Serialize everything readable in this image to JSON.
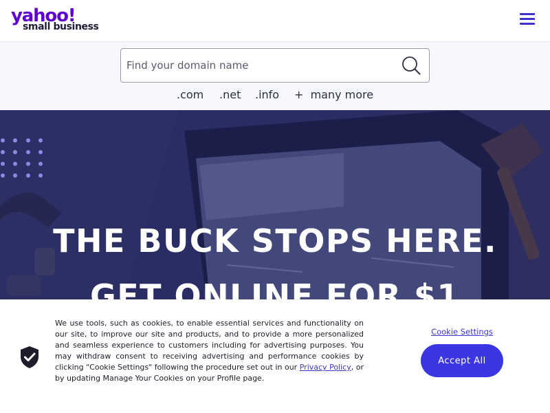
{
  "header": {
    "logo_main": "yahoo!",
    "logo_sub": "small business",
    "menu_icon": "hamburger-menu-icon",
    "brand_color": "#5f01d1"
  },
  "search": {
    "placeholder": "Find your domain name",
    "value": "",
    "icon": "search-icon",
    "tlds": [
      ".com",
      ".net",
      ".info",
      "+  many more"
    ]
  },
  "hero": {
    "line1": "THE BUCK STOPS HERE.",
    "line2": "GET ONLINE FOR $1"
  },
  "cookie_banner": {
    "text_before_link": "We use tools, such as cookies, to enable essential services and functionality on our site, to improve our site and products, and to provide a more personalized and seamless experience to customers including for advertising purposes. You may withdraw consent to receiving advertising and performance cookies by clicking \"Cookie Settings\" following the procedure set out in our ",
    "privacy_link": "Privacy Policy",
    "text_after_link": ", or by updating Manage Your Cookies on your Profile page.",
    "settings_label": "Cookie Settings",
    "accept_label": "Accept All",
    "icon": "shield-check-icon",
    "accent_color": "#3b35e2"
  }
}
